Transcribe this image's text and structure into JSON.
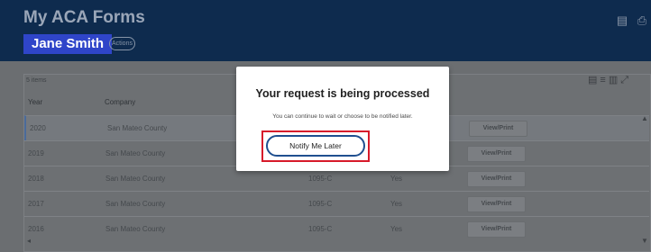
{
  "header": {
    "title": "My ACA Forms",
    "user_name": "Jane Smith",
    "actions_label": "Actions",
    "icons": [
      "export-icon",
      "print-icon"
    ]
  },
  "table": {
    "items_count": "5 items",
    "columns": [
      "Year",
      "Company"
    ],
    "rows": [
      {
        "year": "2020",
        "company": "San Mateo County",
        "form": "",
        "status": "",
        "action": "View/Print"
      },
      {
        "year": "2019",
        "company": "San Mateo County",
        "form": "",
        "status": "",
        "action": "View/Print"
      },
      {
        "year": "2018",
        "company": "San Mateo County",
        "form": "1095-C",
        "status": "Yes",
        "action": "View/Print"
      },
      {
        "year": "2017",
        "company": "San Mateo County",
        "form": "1095-C",
        "status": "Yes",
        "action": "View/Print"
      },
      {
        "year": "2016",
        "company": "San Mateo County",
        "form": "1095-C",
        "status": "Yes",
        "action": "View/Print"
      }
    ],
    "toolbar_icons": [
      "export-icon",
      "filter-icon",
      "columns-icon",
      "fullscreen-icon"
    ]
  },
  "modal": {
    "title": "Your request is being processed",
    "message": "You can continue to wait or choose to be notified later.",
    "button_label": "Notify Me Later",
    "highlight_color": "#d71a2a"
  }
}
